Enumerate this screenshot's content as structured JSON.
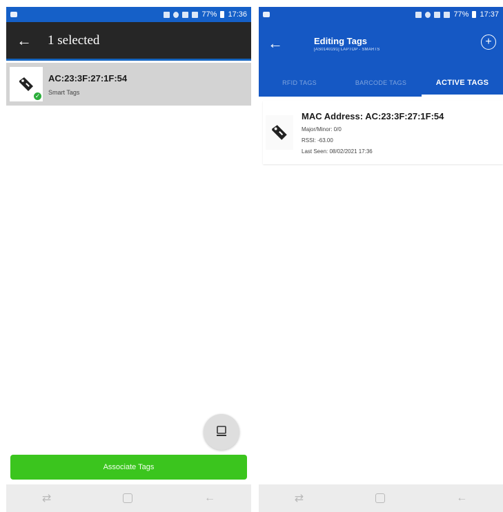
{
  "left": {
    "selection_title": "1 selected",
    "tag": {
      "mac": "AC:23:3F:27:1F:54",
      "type": "Smart Tags"
    },
    "associate_button": "Associate Tags",
    "status_time": "17:36",
    "status_battery": "77%"
  },
  "right": {
    "title": "Editing Tags",
    "subtitle": "[AS0140191] LAPTOP - SMARTS",
    "tabs": [
      "RFID TAGS",
      "BARCODE TAGS",
      "ACTIVE TAGS"
    ],
    "active_tab": "ACTIVE TAGS",
    "card": {
      "mac_line": "MAC Address: AC:23:3F:27:1F:54",
      "major_minor": "Major/Minor: 0/0",
      "rssi": "RSSI: -63.00",
      "last_seen": "Last Seen: 08/02/2021 17:36"
    },
    "status_time": "17:37",
    "status_battery": "77%"
  },
  "icons": {
    "back": "arrow-left-icon",
    "tag": "tag-icon",
    "check": "check-icon",
    "add": "add-circle-icon",
    "fab": "device-icon",
    "nav_recent": "recent-apps-icon",
    "nav_home": "home-icon",
    "nav_back": "back-icon"
  },
  "colors": {
    "brand_blue": "#1558c4",
    "status_blue": "#1560c8",
    "appbar_dark": "#262626",
    "selected_row": "#d3d3d3",
    "associate_green": "#3bc51e",
    "check_green": "#2cae3b"
  }
}
